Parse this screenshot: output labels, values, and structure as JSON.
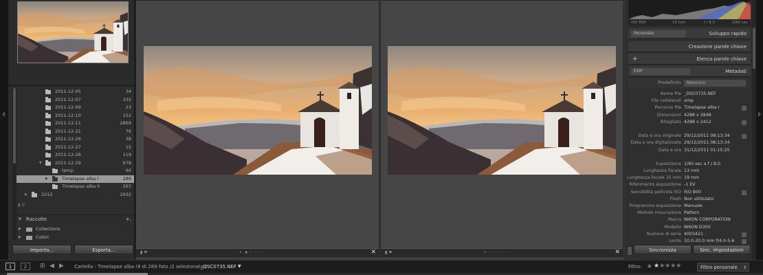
{
  "folders": [
    {
      "name": "2011-12-05",
      "count": "34"
    },
    {
      "name": "2011-12-07",
      "count": "335"
    },
    {
      "name": "2011-12-09",
      "count": "23"
    },
    {
      "name": "2011-12-10",
      "count": "152"
    },
    {
      "name": "2011-12-11",
      "count": "2869"
    },
    {
      "name": "2011-12-21",
      "count": "76"
    },
    {
      "name": "2011-12-26",
      "count": "38"
    },
    {
      "name": "2011-12-27",
      "count": "15"
    },
    {
      "name": "2011-12-28",
      "count": "119"
    },
    {
      "name": "2011-12-29",
      "count": "678"
    },
    {
      "name": "temp",
      "count": "60"
    },
    {
      "name": "Timelapse alba I",
      "count": "289"
    },
    {
      "name": "Timelapse alba II",
      "count": "267"
    },
    {
      "name": "2012",
      "count": "2932"
    }
  ],
  "left": {
    "collections_header": "Raccolte",
    "collections": [
      {
        "name": "Collections"
      },
      {
        "name": "Colori"
      }
    ],
    "import_label": "Importa...",
    "export_label": "Esporta..."
  },
  "right": {
    "hist_iso": "ISO 800",
    "hist_focal": "13 mm",
    "hist_aperture": "f / 8,0",
    "hist_shutter": "1/60 sec",
    "quick_develop_preset": "Personale",
    "quick_develop_title": "Sviluppo rapido",
    "keywording_title": "Creazione parole chiave",
    "keyword_list_title": "Elenco parole chiave",
    "metadata_preset": "EXIF",
    "metadata_title": "Metadati",
    "default_label": "Predefinito",
    "default_value": "Nessuno",
    "sync_label": "Sincronizza",
    "sync_settings_label": "Sinc. impostazioni"
  },
  "metadata": [
    {
      "label": "Nome file",
      "value": "_DSC0735.NEF"
    },
    {
      "label": "File collaterali",
      "value": "xmp"
    },
    {
      "label": "Percorso file",
      "value": "Timelapse alba I"
    },
    {
      "label": "Dimensioni",
      "value": "4288 x 2848"
    },
    {
      "label": "Ritagliato",
      "value": "4288 x 2412"
    },
    {
      "label": "",
      "value": ""
    },
    {
      "label": "Data e ora originale",
      "value": "29/12/2011 08:13:34"
    },
    {
      "label": "Data e ora digitalizzate",
      "value": "29/12/2011 08:13:34"
    },
    {
      "label": "Data e ora",
      "value": "31/12/2011 01:15:25"
    },
    {
      "label": "",
      "value": ""
    },
    {
      "label": "Esposizione",
      "value": "1/60 sec a f / 8,0"
    },
    {
      "label": "Lunghezza focale",
      "value": "13 mm"
    },
    {
      "label": "Lunghezza focale 35 mm",
      "value": "19 mm"
    },
    {
      "label": "Riferimento esposizione",
      "value": "-1 EV"
    },
    {
      "label": "Sensibilità pellicola ISO",
      "value": "ISO 800"
    },
    {
      "label": "Flash",
      "value": "Non utilizzato"
    },
    {
      "label": "Programma esposizione",
      "value": "Manuale"
    },
    {
      "label": "Metodo misurazione",
      "value": "Pattern"
    },
    {
      "label": "Marca",
      "value": "NIKON CORPORATION"
    },
    {
      "label": "Modello",
      "value": "NIKON D300"
    },
    {
      "label": "Numero di serie",
      "value": "4003421"
    },
    {
      "label": "Lente",
      "value": "10.0-20.0 mm f/4.0-5.6"
    }
  ],
  "bottom": {
    "view1": "1",
    "view2": "2",
    "breadcrumb": "Cartella : Timelapse alba I",
    "count": "8 di 289 foto /2 selezionata /",
    "filename": "_DSC0735.NEF",
    "filter_label": "Filtro:",
    "filter_op": "≥",
    "filter_preset": "Filtro personale"
  },
  "colors": {
    "accent": "#d6d6d6",
    "selected_row": "#9a9a9a"
  }
}
